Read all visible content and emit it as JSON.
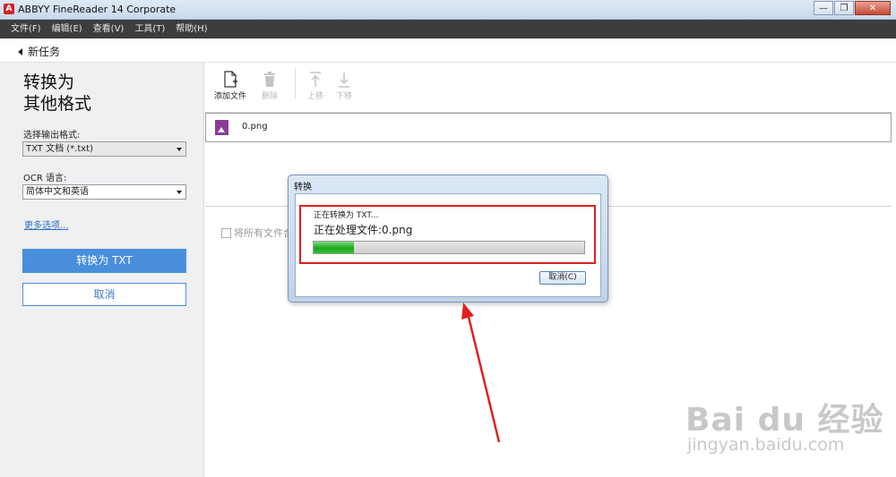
{
  "window": {
    "title": "ABBYY FineReader 14 Corporate",
    "logo_letter": "A",
    "controls": {
      "minimize": "—",
      "restore": "❐",
      "close": "✕"
    }
  },
  "menu": {
    "items": [
      {
        "label": "文件(F)"
      },
      {
        "label": "编辑(E)"
      },
      {
        "label": "查看(V)"
      },
      {
        "label": "工具(T)"
      },
      {
        "label": "帮助(H)"
      }
    ]
  },
  "nav": {
    "back_label": "新任务"
  },
  "left_panel": {
    "title_line1": "转换为",
    "title_line2": "其他格式",
    "format_label": "选择输出格式:",
    "format_value": "TXT 文档 (*.txt)",
    "ocr_label": "OCR 语言:",
    "ocr_value": "简体中文和英语",
    "more_options": "更多选项...",
    "convert_button": "转换为 TXT",
    "cancel_button": "取消"
  },
  "toolbar": {
    "add_file": "添加文件",
    "delete": "删除",
    "move_up": "上移",
    "move_down": "下移"
  },
  "files": [
    {
      "name": "0.png"
    }
  ],
  "combine_label": "将所有文件合",
  "dialog": {
    "title": "转换",
    "status_line1": "正在转换为 TXT...",
    "status_line2": "正在处理文件:0.png",
    "progress": 0.15,
    "cancel_button": "取消(C)"
  },
  "watermark": {
    "brand": "Bai du 经验",
    "url": "jingyan.baidu.com"
  },
  "colors": {
    "accent": "#4a8fdc",
    "annotation": "#e02020",
    "progress": "#1fa71f"
  }
}
